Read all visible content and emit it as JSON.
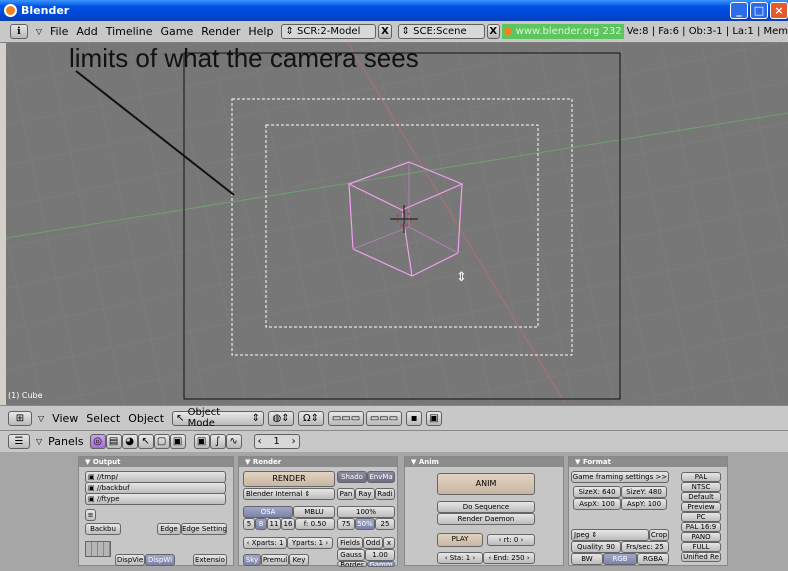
{
  "window": {
    "title": "Blender",
    "min": "_",
    "max": "□",
    "close": "×"
  },
  "info": {
    "menu": [
      "File",
      "Add",
      "Timeline",
      "Game",
      "Render",
      "Help"
    ],
    "screen": "SCR:2-Model",
    "scene": "SCE:Scene",
    "close_x": "X",
    "url": "www.blender.org 232",
    "stats": "Ve:8 | Fa:6 | Ob:3-1 | La:1 | Mem"
  },
  "viewport": {
    "annotation": "limits of what the camera sees",
    "object_label": "(1) Cube"
  },
  "view_header": {
    "menu": [
      "View",
      "Select",
      "Object"
    ],
    "mode": "Object Mode"
  },
  "buttons_header": {
    "label": "Panels",
    "frame": "1"
  },
  "output": {
    "title": "Output",
    "paths": [
      "//tmp/",
      "//backbuf",
      "//ftype"
    ],
    "backbuf": "Backbu",
    "edge": "Edge",
    "edge_settings": "Edge Setting",
    "disp_view": "DispVie",
    "disp_win": "DispWi",
    "extensions": "Extensio"
  },
  "render": {
    "title": "Render",
    "render_btn": "RENDER",
    "engine": "Blender Internal",
    "shadow": "Shado",
    "envmap": "EnvMa",
    "pano": "Pan",
    "ray": "Ray",
    "radio": "Radi",
    "osa": "OSA",
    "mblur": "MBLU",
    "percent": "100%",
    "osa_levels": [
      "5",
      "8",
      "11",
      "16"
    ],
    "filter": "f: 0.50",
    "sizes": [
      "75",
      "50%",
      "25"
    ],
    "xparts": "Xparts: 1",
    "yparts": "Yparts: 1",
    "fields": "Fields",
    "odd": "Odd",
    "x": "x",
    "gauss": "Gauss",
    "gauss_val": "1.00",
    "sky": "Sky",
    "premul": "Premul",
    "key": "Key",
    "border": "Border",
    "gamma": "Gamm"
  },
  "anim": {
    "title": "Anim",
    "anim_btn": "ANIM",
    "do_sequence": "Do Sequence",
    "render_daemon": "Render Daemon",
    "play": "PLAY",
    "rt": "rt: 0",
    "sta": "Sta: 1",
    "end": "End: 250"
  },
  "format": {
    "title": "Format",
    "game_framing": "Game framing settings",
    "sizex": "SizeX: 640",
    "sizey": "SizeY: 480",
    "aspx": "AspX: 100",
    "aspy": "AspY: 100",
    "filetype": "Jpeg",
    "crop": "Crop",
    "quality": "Quality: 90",
    "fps": "Frs/sec: 25",
    "bw": "BW",
    "rgb": "RGB",
    "rgba": "RGBA",
    "presets": [
      "PAL",
      "NTSC",
      "Default",
      "Preview",
      "PC",
      "PAL 16:9",
      "PANO",
      "FULL",
      "Unified Re"
    ]
  }
}
